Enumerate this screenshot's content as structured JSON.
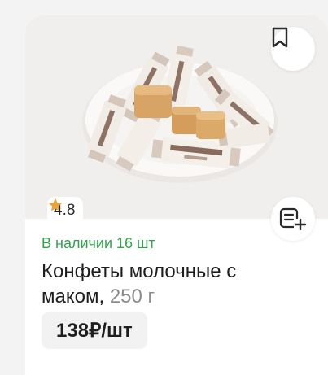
{
  "product": {
    "rating": "4.8",
    "stock": "В наличии 16 шт",
    "title": "Конфеты молочные с маком,",
    "weight": "250 г",
    "price": "138₽/шт"
  },
  "icons": {
    "bookmark": "bookmark-icon",
    "add_to_list": "add-to-list-icon",
    "rating": "star-icon"
  },
  "colors": {
    "stock_green": "#2fa44a",
    "star": "#e8a33a",
    "card_bg": "#ffffff",
    "page_bg": "#f3f3f3"
  }
}
